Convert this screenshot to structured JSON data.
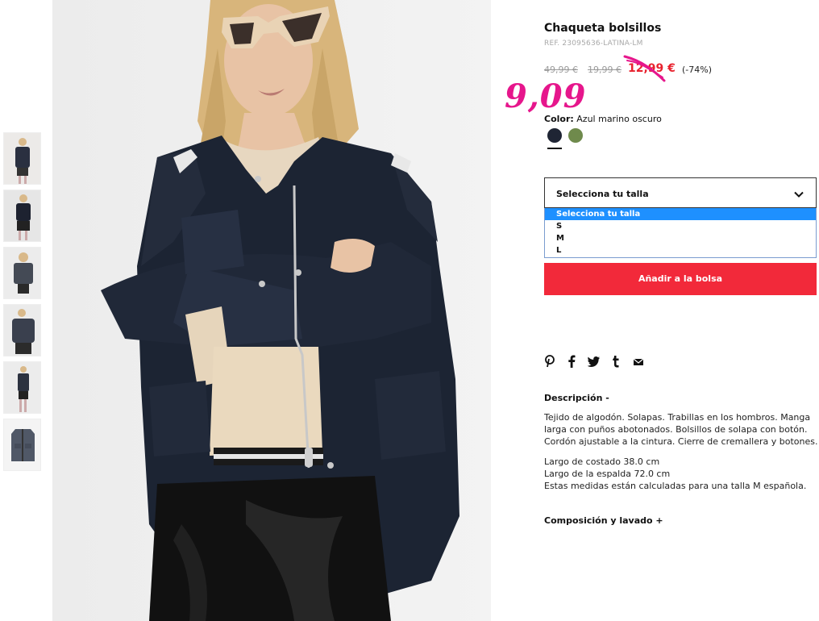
{
  "product": {
    "title": "Chaqueta bolsillos",
    "ref": "REF. 23095636-LATINA-LM",
    "prices": {
      "original": "49,99 €",
      "previous": "19,99 €",
      "sale": "12,99 €",
      "discount": "(-74%)"
    },
    "handwritten_price": "9,09",
    "color": {
      "label": "Color:",
      "value": "Azul marino oscuro"
    },
    "swatches": [
      "#1f2534",
      "#6f8a4c"
    ]
  },
  "size": {
    "selected": "Selecciona tu talla",
    "options": [
      "Selecciona tu talla",
      "S",
      "M",
      "L"
    ]
  },
  "add_to_bag": "Añadir a la bolsa",
  "share_icons": [
    "pinterest-icon",
    "facebook-icon",
    "twitter-icon",
    "tumblr-icon",
    "email-icon"
  ],
  "description": {
    "title": "Descripción -",
    "lines1": [
      "Tejido de algodón. Solapas. Trabillas en los hombros. Manga",
      "larga con puños abotonados. Bolsillos de solapa con botón.",
      "Cordón ajustable a la cintura. Cierre de cremallera y botones."
    ],
    "lines2": [
      "Largo de costado 38.0 cm",
      "Largo de la espalda 72.0 cm",
      "Estas medidas están calculadas para una talla M española."
    ]
  },
  "composition_title": "Composición y lavado +",
  "colors": {
    "accent_red": "#f2293a",
    "sale_red": "#e8222e",
    "handwriting_pink": "#e6168c",
    "select_blue": "#1e90ff"
  }
}
